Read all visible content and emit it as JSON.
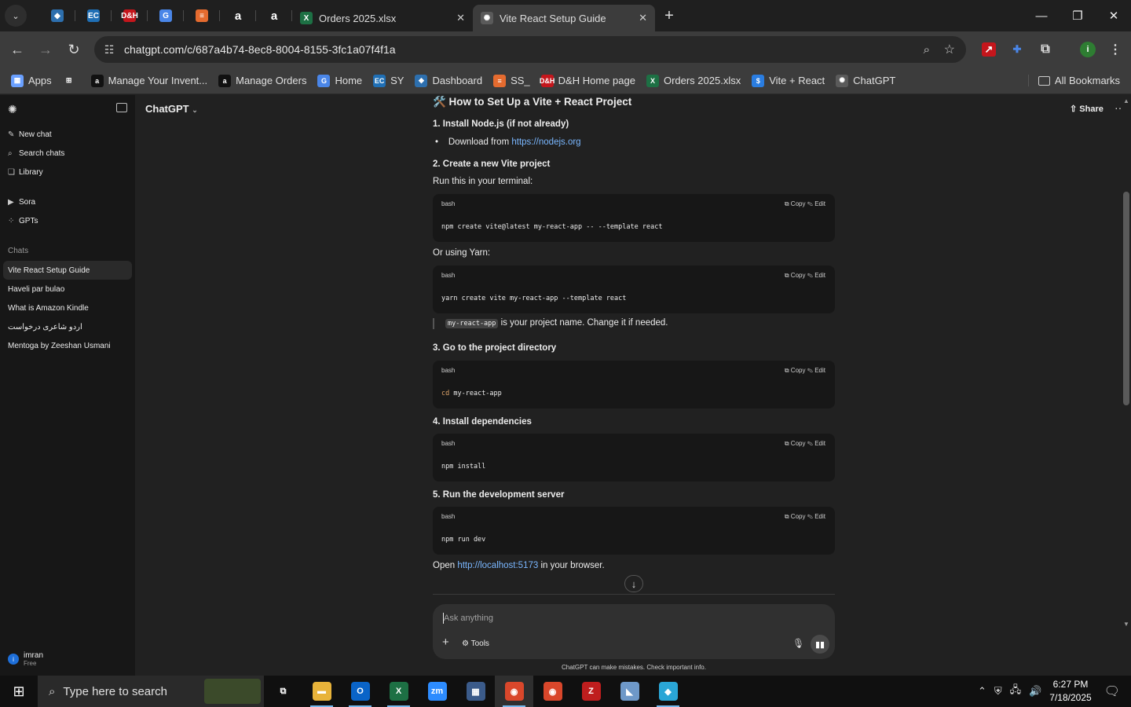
{
  "browser": {
    "tabs_pinned": [
      {
        "icon": "arrow-diamond-icon",
        "color": "#2d6fae",
        "glyph": "◆"
      },
      {
        "icon": "ec-icon",
        "color": "#1f6fb5",
        "glyph": "EC"
      },
      {
        "icon": "dh-icon",
        "color": "#c4161c",
        "glyph": "D&H"
      },
      {
        "icon": "g-docs-icon",
        "color": "#4a86e8",
        "glyph": "G"
      },
      {
        "icon": "stack-icon",
        "color": "#e56b2f",
        "glyph": "≡"
      },
      {
        "icon": "amazon-icon",
        "color": "#ffffff",
        "glyph": "a"
      },
      {
        "icon": "amazon-icon",
        "color": "#ffffff",
        "glyph": "a"
      }
    ],
    "tabs": [
      {
        "title": "Orders 2025.xlsx",
        "icon": "excel-icon",
        "color": "#1d7044"
      },
      {
        "title": "Vite React Setup Guide",
        "icon": "openai-icon",
        "color": "#9a9a9a"
      }
    ],
    "url": "chatgpt.com/c/687a4b74-8ec8-8004-8155-3fc1a07f4f1a",
    "bookmarks": [
      {
        "label": "Apps",
        "icon": "apps-grid-icon",
        "color": "#6aa0ff",
        "glyph": "▦"
      },
      {
        "label": "",
        "icon": "tab-groups-icon",
        "color": "#3c3c3c",
        "glyph": "⊞"
      },
      {
        "label": "Manage Your Invent...",
        "icon": "amazon-icon",
        "color": "#ffffff",
        "glyph": "a"
      },
      {
        "label": "Manage Orders",
        "icon": "amazon-icon",
        "color": "#ffffff",
        "glyph": "a"
      },
      {
        "label": "Home",
        "icon": "g-docs-icon",
        "color": "#4a86e8",
        "glyph": "G"
      },
      {
        "label": "SY",
        "icon": "ec-icon",
        "color": "#1f6fb5",
        "glyph": "EC"
      },
      {
        "label": "Dashboard",
        "icon": "diamond-icon",
        "color": "#2d6fae",
        "glyph": "◆"
      },
      {
        "label": "SS_",
        "icon": "stack-icon",
        "color": "#e56b2f",
        "glyph": "≡"
      },
      {
        "label": "D&H Home page",
        "icon": "dh-icon",
        "color": "#c4161c",
        "glyph": "D&H"
      },
      {
        "label": "Orders 2025.xlsx",
        "icon": "excel-icon",
        "color": "#1d7044",
        "glyph": "X"
      },
      {
        "label": "Vite + React",
        "icon": "dollar-icon",
        "color": "#2a7de1",
        "glyph": "$"
      },
      {
        "label": "ChatGPT",
        "icon": "openai-icon",
        "color": "#5a5a5a",
        "glyph": "✺"
      }
    ],
    "all_bookmarks": "All Bookmarks"
  },
  "sidebar": {
    "nav": [
      {
        "label": "New chat",
        "icon": "edit-icon",
        "glyph": "✎"
      },
      {
        "label": "Search chats",
        "icon": "search-icon",
        "glyph": "⌕"
      },
      {
        "label": "Library",
        "icon": "library-icon",
        "glyph": "❏"
      },
      {
        "label": "Sora",
        "icon": "play-icon",
        "glyph": "▶"
      },
      {
        "label": "GPTs",
        "icon": "grid-icon",
        "glyph": "⁘"
      }
    ],
    "chats_heading": "Chats",
    "chats": [
      "Vite React Setup Guide",
      "Haveli par bulao",
      "What is Amazon Kindle",
      "اردو شاعری درخواست",
      "Mentoga by Zeeshan Usmani"
    ],
    "user": {
      "name": "imran",
      "plan": "Free",
      "initial": "i"
    }
  },
  "header": {
    "model": "ChatGPT",
    "share": "Share"
  },
  "article": {
    "title": "🛠️ How to Set Up a Vite + React Project",
    "s1": "1. Install Node.js (if not already)",
    "s1_bullet": "Download from ",
    "s1_link": "https://nodejs.org",
    "s2": "2. Create a new Vite project",
    "s2_text": "Run this in your terminal:",
    "code_lang": "bash",
    "code_actions": "⧉ Copy   ✎ Edit",
    "code1": "npm create vite@latest my-react-app -- --template react",
    "or_yarn": "Or using Yarn:",
    "code2": "yarn create vite my-react-app --template react",
    "note_code": "my-react-app",
    "note_text": " is your project name. Change it if needed.",
    "s3": "3. Go to the project directory",
    "code3_cmd": "cd",
    "code3_arg": " my-react-app",
    "s4": "4. Install dependencies",
    "code4": "npm install",
    "s5": "5. Run the development server",
    "code5": "npm run dev",
    "open_pre": "Open ",
    "open_link": "http://localhost:5173",
    "open_post": " in your browser."
  },
  "composer": {
    "placeholder": "Ask anything",
    "tools": "Tools"
  },
  "disclaimer": "ChatGPT can make mistakes. Check important info.",
  "taskbar": {
    "search_placeholder": "Type here to search",
    "apps": [
      {
        "icon": "task-view-icon",
        "color": "#101010",
        "glyph": "⧉",
        "open": false
      },
      {
        "icon": "file-explorer-icon",
        "color": "#e8b33a",
        "glyph": "▬",
        "open": true
      },
      {
        "icon": "outlook-icon",
        "color": "#0a64c8",
        "glyph": "O",
        "open": true
      },
      {
        "icon": "excel-icon",
        "color": "#1d7044",
        "glyph": "X",
        "open": true
      },
      {
        "icon": "zoom-icon",
        "color": "#2d8cff",
        "glyph": "zm",
        "open": false
      },
      {
        "icon": "calculator-icon",
        "color": "#3b5b8a",
        "glyph": "▦",
        "open": false
      },
      {
        "icon": "chrome-icon",
        "color": "#d9472b",
        "glyph": "◉",
        "open": true
      },
      {
        "icon": "chrome-icon",
        "color": "#d9472b",
        "glyph": "◉",
        "open": false
      },
      {
        "icon": "filezilla-icon",
        "color": "#bf1e1e",
        "glyph": "Z",
        "open": false
      },
      {
        "icon": "app-blue-icon",
        "color": "#6e98c8",
        "glyph": "◣",
        "open": false
      },
      {
        "icon": "app-diamond-icon",
        "color": "#2aa6d6",
        "glyph": "◆",
        "open": true
      }
    ],
    "time": "6:27 PM",
    "date": "7/18/2025"
  }
}
